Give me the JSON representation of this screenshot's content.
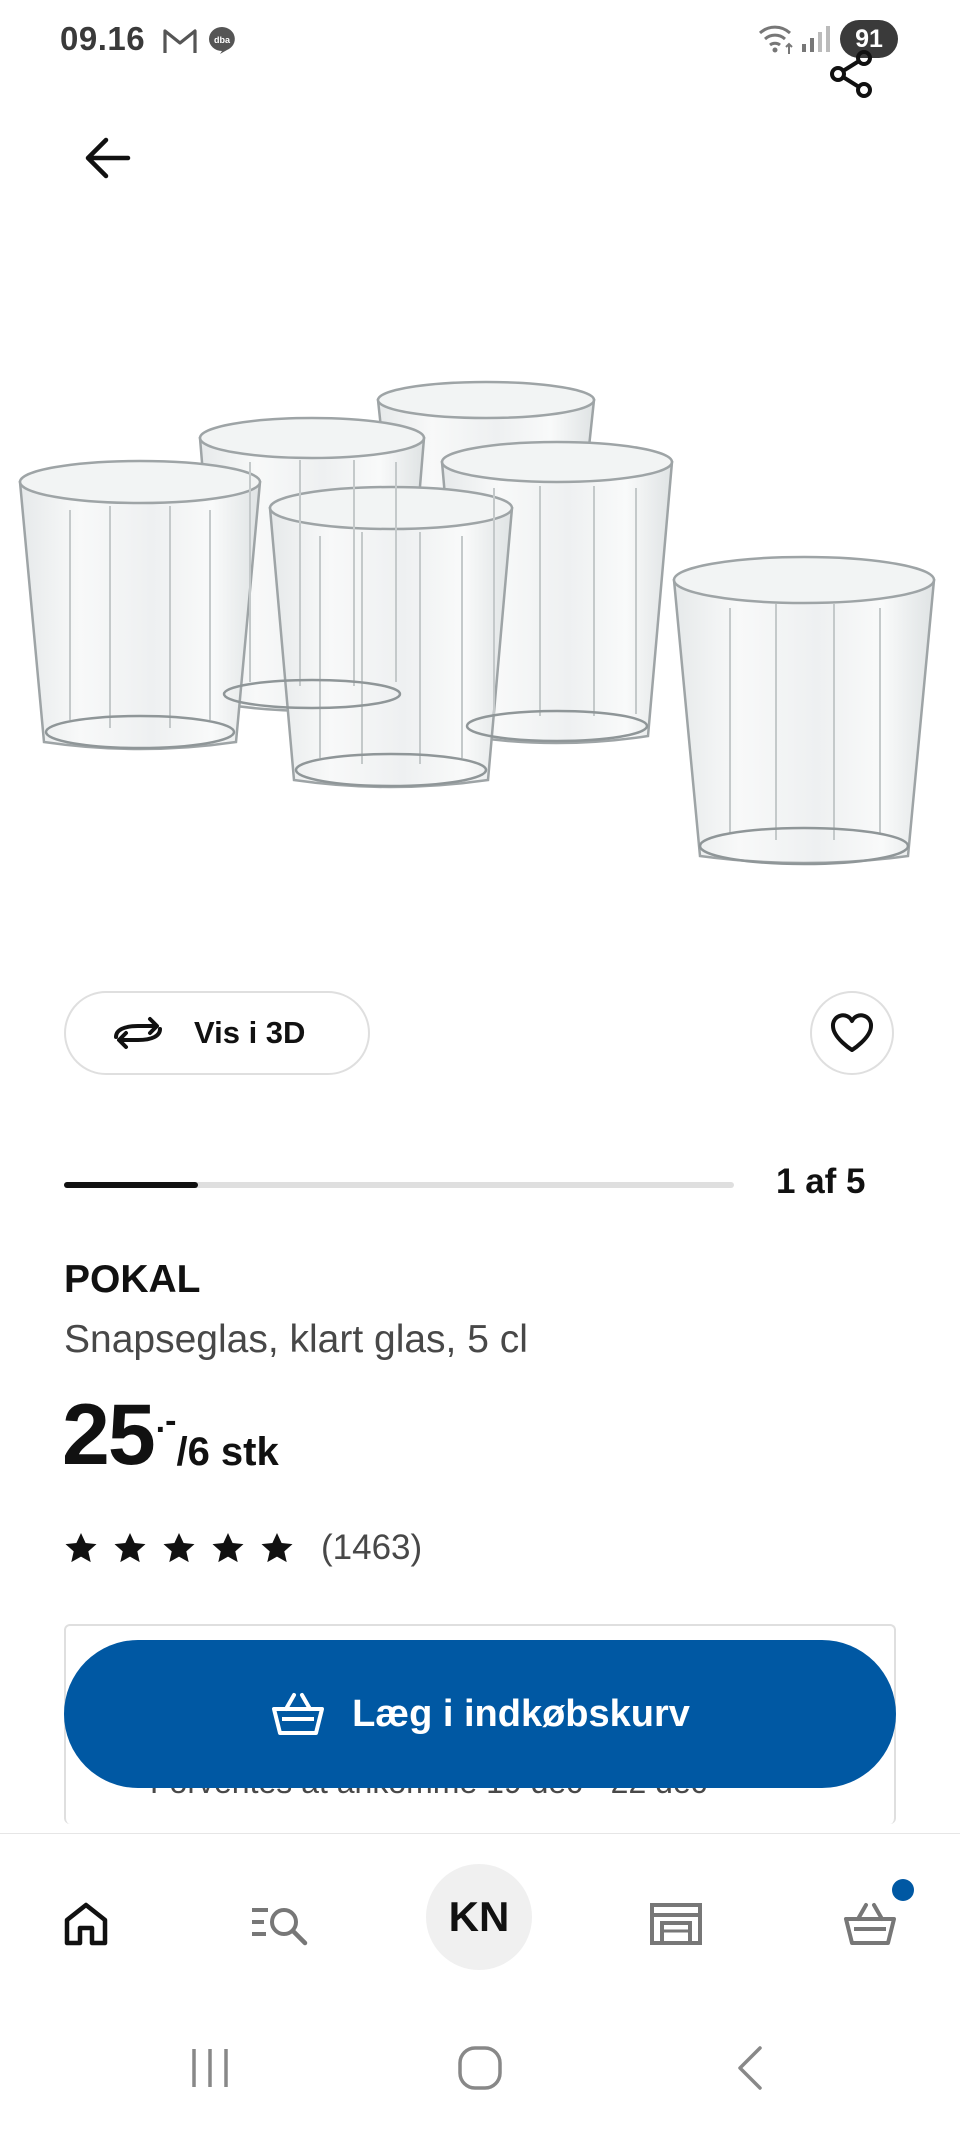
{
  "status_bar": {
    "time": "09.16",
    "battery": "91",
    "icons": [
      "gmail-icon",
      "dba-icon",
      "wifi-icon",
      "signal-icon"
    ]
  },
  "top_bar": {
    "back_icon": "arrow-left-icon",
    "share_icon": "share-icon"
  },
  "product_image": {
    "icon": "glasses-image"
  },
  "view_3d": {
    "label": "Vis i 3D",
    "icon": "rotate-3d-icon"
  },
  "favorite": {
    "icon": "heart-icon"
  },
  "carousel": {
    "counter": "1 af 5",
    "current": 1,
    "total": 5
  },
  "product": {
    "name": "POKAL",
    "description": "Snapseglas, klart glas, 5 cl",
    "price_integer": "25",
    "price_decimal": ".-",
    "price_unit": "/6 stk",
    "rating": 5,
    "rating_max": 5,
    "review_count": "(1463)"
  },
  "delivery": {
    "text": "Forventes at ankomme 19 dec - 22 dec"
  },
  "cart_button": {
    "label": "Læg i indkøbskurv",
    "icon": "basket-icon"
  },
  "bottom_nav": {
    "items": [
      {
        "name": "home",
        "icon": "home-icon"
      },
      {
        "name": "search",
        "icon": "search-list-icon"
      },
      {
        "name": "profile",
        "initials": "KN"
      },
      {
        "name": "store",
        "icon": "store-icon"
      },
      {
        "name": "cart",
        "icon": "basket-icon"
      }
    ]
  },
  "colors": {
    "accent": "#0058a3",
    "text": "#111111",
    "muted": "#484848",
    "border": "#dfdfdf"
  }
}
